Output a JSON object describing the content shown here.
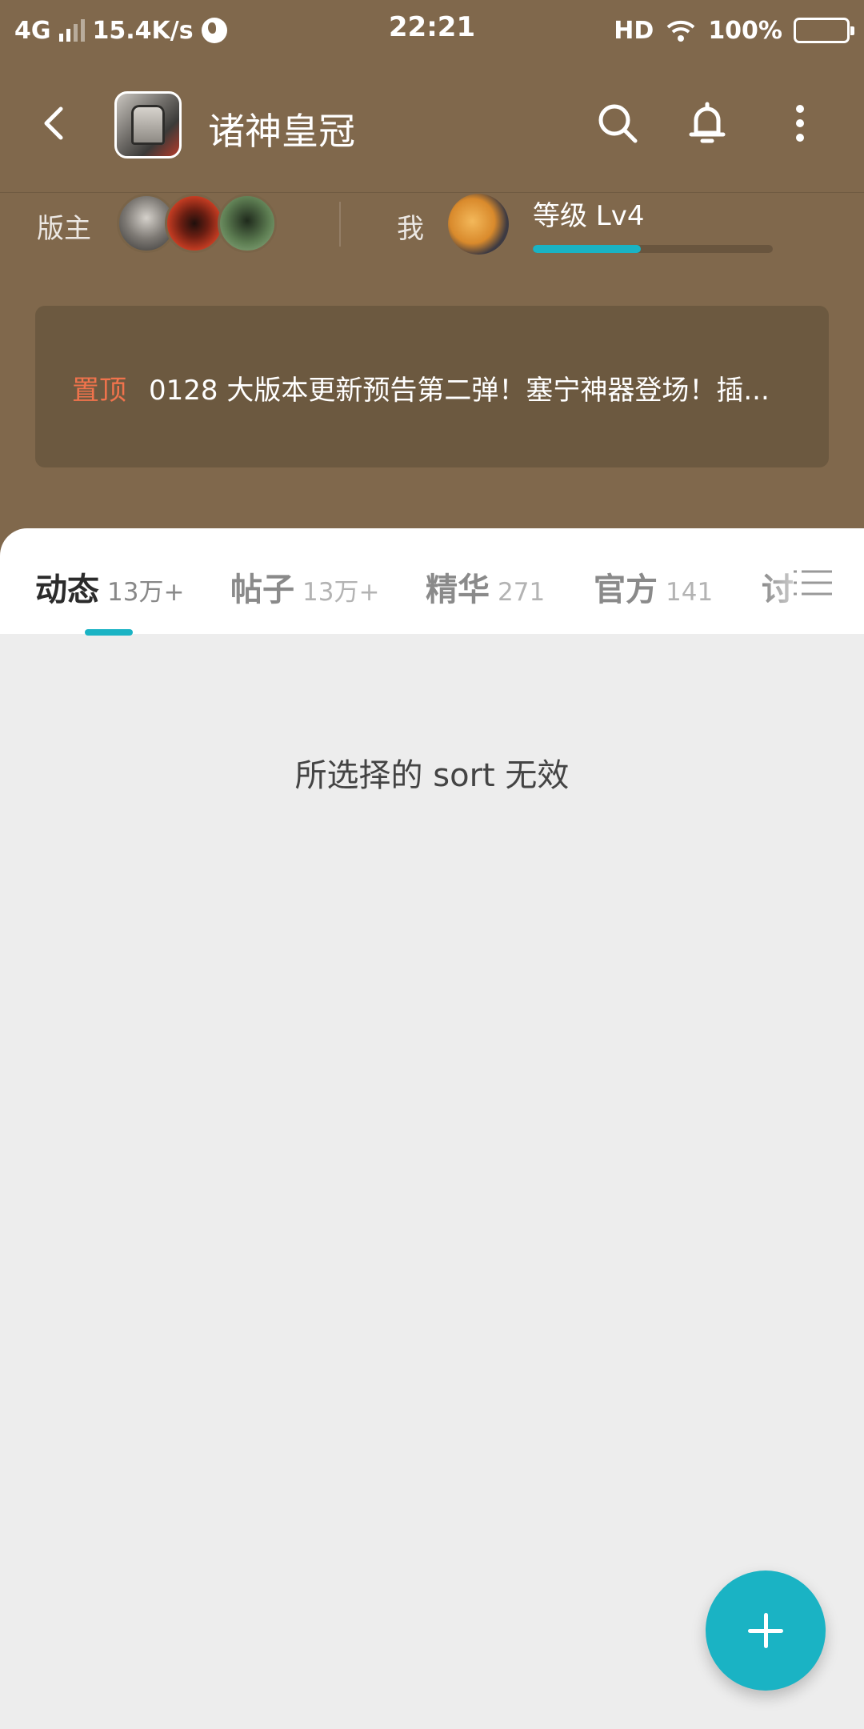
{
  "status_bar": {
    "network": "4G",
    "speed": "15.4K/s",
    "time": "22:21",
    "hd": "HD",
    "battery": "100%"
  },
  "header": {
    "title": "诸神皇冠",
    "icons": [
      "back-arrow-icon",
      "search-icon",
      "bell-icon",
      "more-vertical-icon"
    ]
  },
  "moderators": {
    "label": "版主",
    "avatar_count": 3
  },
  "me": {
    "label": "我",
    "level_label": "等级 Lv4",
    "level_progress": 0.45
  },
  "pinned": {
    "tag": "置顶",
    "text": "0128 大版本更新预告第二弹！塞宁神器登场！插..."
  },
  "tabs": [
    {
      "label": "动态",
      "count": "13万+",
      "active": true
    },
    {
      "label": "帖子",
      "count": "13万+",
      "active": false
    },
    {
      "label": "精华",
      "count": "271",
      "active": false
    },
    {
      "label": "官方",
      "count": "141",
      "active": false
    },
    {
      "label": "讨",
      "count": "",
      "active": false
    }
  ],
  "empty_message": "所选择的 sort 无效",
  "colors": {
    "header_bg": "#80684c",
    "pinned_bg": "#6c5940",
    "accent": "#1ab3c4",
    "pin_tag": "#f0734c",
    "content_bg": "#ededed"
  }
}
